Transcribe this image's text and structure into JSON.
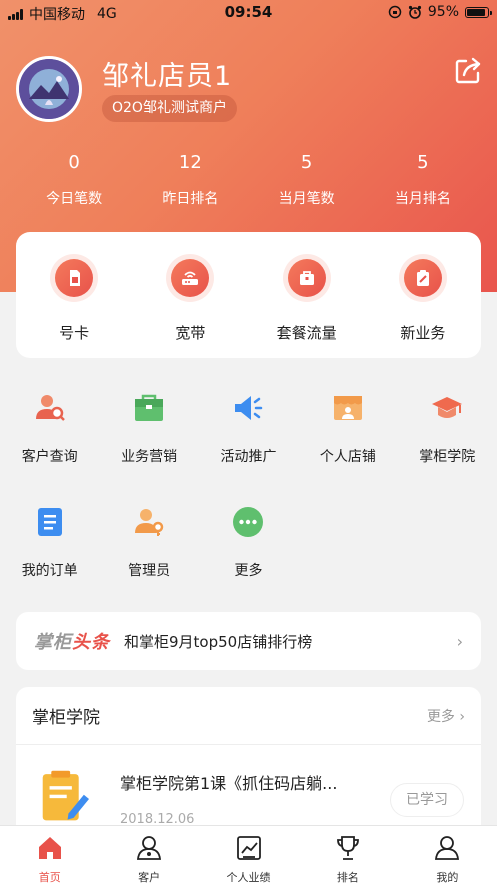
{
  "status_bar": {
    "carrier": "中国移动",
    "network": "4G",
    "time": "09:54",
    "battery": "95%"
  },
  "profile": {
    "name": "邹礼店员1",
    "merchant": "O2O邹礼测试商户"
  },
  "stats": [
    {
      "value": "0",
      "label": "今日笔数"
    },
    {
      "value": "12",
      "label": "昨日排名"
    },
    {
      "value": "5",
      "label": "当月笔数"
    },
    {
      "value": "5",
      "label": "当月排名"
    }
  ],
  "quick_services": [
    {
      "label": "号卡",
      "icon": "sim-card-icon"
    },
    {
      "label": "宽带",
      "icon": "router-icon"
    },
    {
      "label": "套餐流量",
      "icon": "package-icon"
    },
    {
      "label": "新业务",
      "icon": "clipboard-icon"
    }
  ],
  "functions": [
    {
      "label": "客户查询",
      "icon": "customer-search-icon"
    },
    {
      "label": "业务营销",
      "icon": "briefcase-icon"
    },
    {
      "label": "活动推广",
      "icon": "megaphone-icon"
    },
    {
      "label": "个人店铺",
      "icon": "store-icon"
    },
    {
      "label": "掌柜学院",
      "icon": "graduation-cap-icon"
    },
    {
      "label": "我的订单",
      "icon": "order-icon"
    },
    {
      "label": "管理员",
      "icon": "admin-icon"
    },
    {
      "label": "更多",
      "icon": "more-icon"
    }
  ],
  "news": {
    "tag_gray": "掌柜",
    "tag_red": "头条",
    "text": "和掌柜9月top50店铺排行榜",
    "chevron": "›"
  },
  "academy": {
    "title": "掌柜学院",
    "more": "更多 ›",
    "course": {
      "title": "掌柜学院第1课《抓住码店躺...",
      "date": "2018.12.06",
      "status": "已学习"
    }
  },
  "tabbar": [
    {
      "label": "首页",
      "active": true
    },
    {
      "label": "客户"
    },
    {
      "label": "个人业绩"
    },
    {
      "label": "排名"
    },
    {
      "label": "我的"
    }
  ],
  "colors": {
    "accent": "#e8524a",
    "header_start": "#f0916a",
    "header_end": "#e9554d"
  }
}
